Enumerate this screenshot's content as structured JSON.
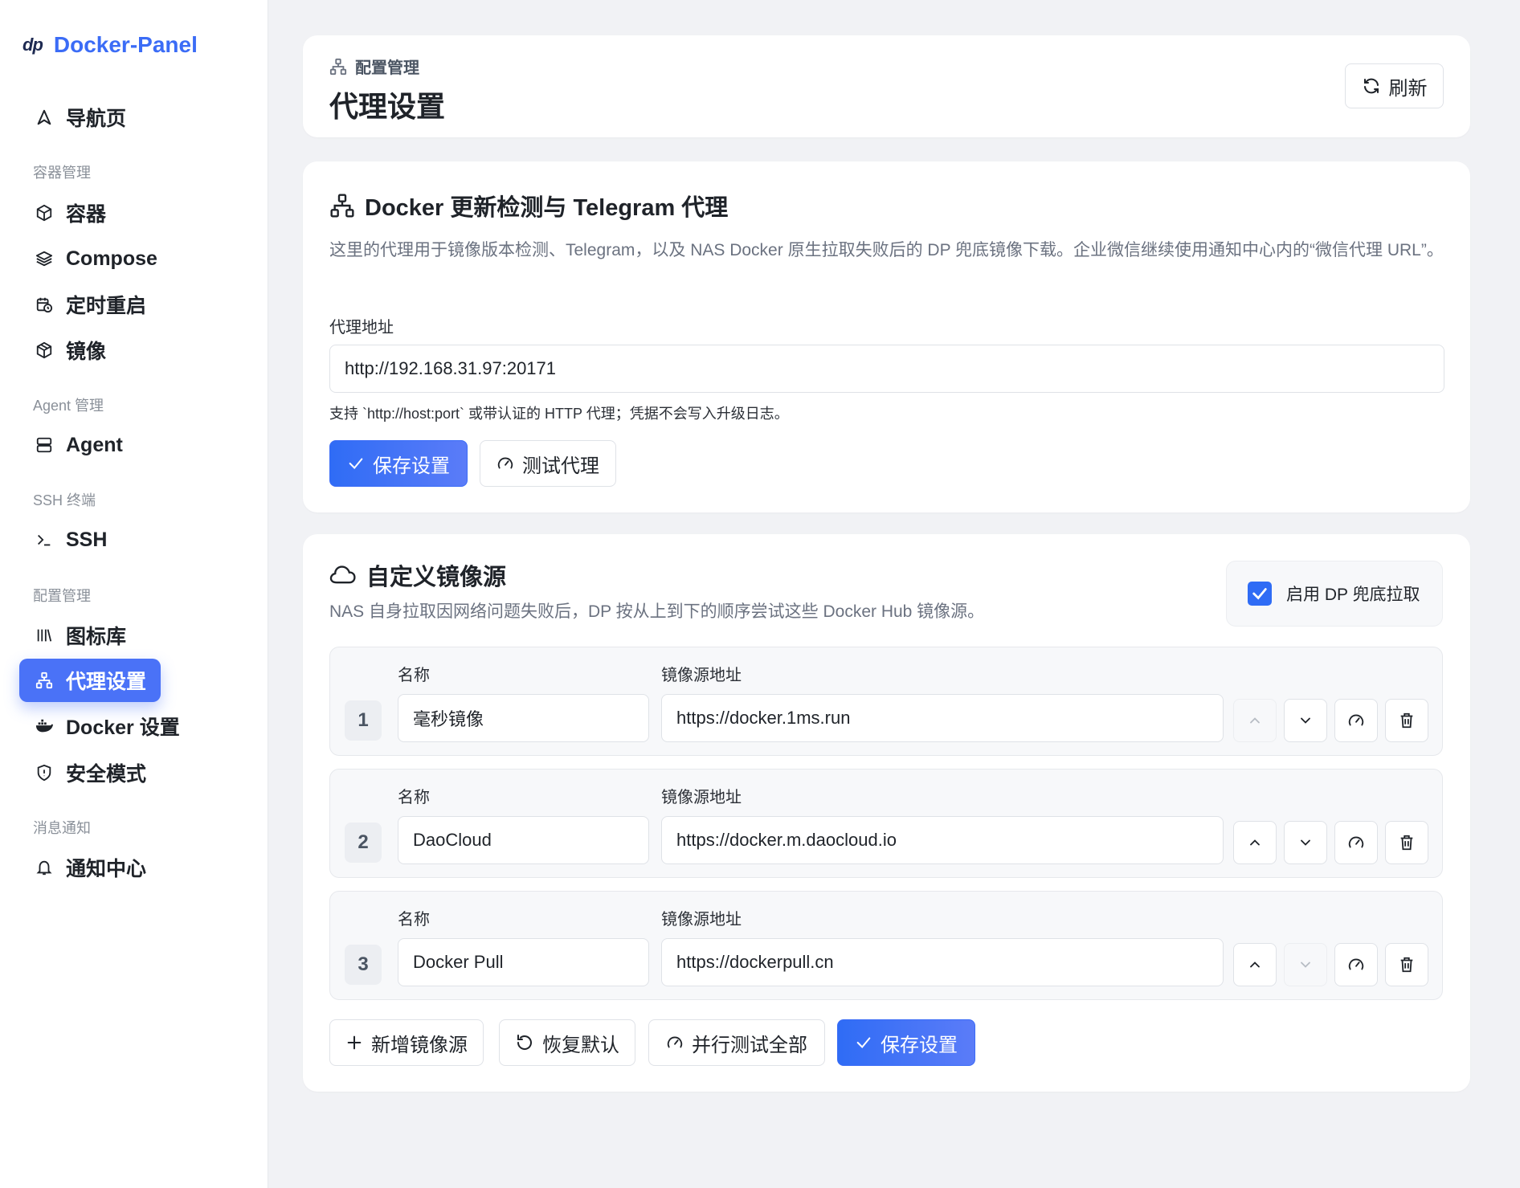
{
  "brand": {
    "logo": "dp",
    "name": "Docker-Panel"
  },
  "sidebar": {
    "home": "导航页",
    "sections": [
      {
        "title": "容器管理",
        "items": [
          "容器",
          "Compose",
          "定时重启",
          "镜像"
        ]
      },
      {
        "title": "Agent 管理",
        "items": [
          "Agent"
        ]
      },
      {
        "title": "SSH 终端",
        "items": [
          "SSH"
        ]
      },
      {
        "title": "配置管理",
        "items": [
          "图标库",
          "代理设置",
          "Docker 设置",
          "安全模式"
        ]
      },
      {
        "title": "消息通知",
        "items": [
          "通知中心"
        ]
      }
    ],
    "active": "代理设置"
  },
  "header": {
    "breadcrumb": "配置管理",
    "title": "代理设置",
    "refresh": "刷新"
  },
  "proxy": {
    "title": "Docker 更新检测与 Telegram 代理",
    "description": "这里的代理用于镜像版本检测、Telegram，以及 NAS Docker 原生拉取失败后的 DP 兜底镜像下载。企业微信继续使用通知中心内的“微信代理 URL”。",
    "field_label": "代理地址",
    "field_value": "http://192.168.31.97:20171",
    "hint": "支持 `http://host:port` 或带认证的 HTTP 代理；凭据不会写入升级日志。",
    "save": "保存设置",
    "test": "测试代理"
  },
  "mirrors": {
    "title": "自定义镜像源",
    "description": "NAS 自身拉取因网络问题失败后，DP 按从上到下的顺序尝试这些 Docker Hub 镜像源。",
    "fallback_label": "启用 DP 兜底拉取",
    "fallback_checked": true,
    "name_label": "名称",
    "url_label": "镜像源地址",
    "rows": [
      {
        "index": "1",
        "name": "毫秒镜像",
        "url": "https://docker.1ms.run"
      },
      {
        "index": "2",
        "name": "DaoCloud",
        "url": "https://docker.m.daocloud.io"
      },
      {
        "index": "3",
        "name": "Docker Pull",
        "url": "https://dockerpull.cn"
      }
    ],
    "actions": {
      "add": "新增镜像源",
      "reset": "恢复默认",
      "test_all": "并行测试全部",
      "save": "保存设置"
    }
  },
  "colors": {
    "accent": "#3b6cf6",
    "background": "#f1f2f5"
  }
}
